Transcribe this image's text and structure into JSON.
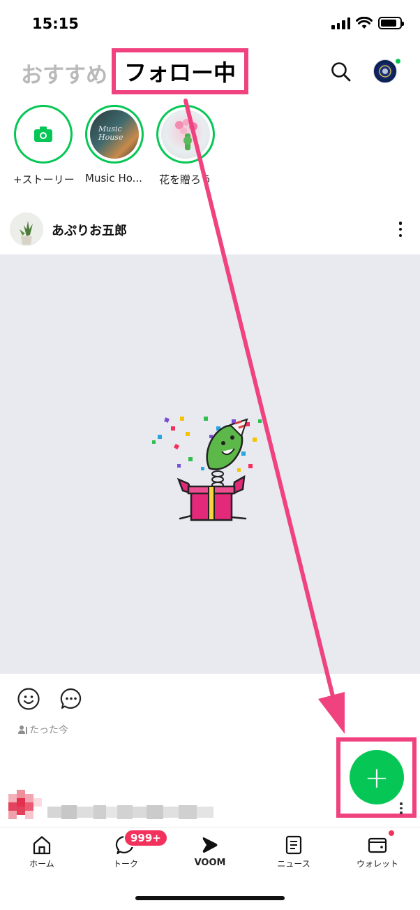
{
  "status_bar": {
    "time": "15:15",
    "battery_level": 0.85
  },
  "header": {
    "tabs": [
      {
        "label": "おすすめ",
        "active": false
      },
      {
        "label": "フォロー中",
        "active": true
      }
    ],
    "search_icon": "search-icon",
    "avatar_icon": "profile-avatar"
  },
  "stories": [
    {
      "label": "+ストーリー",
      "icon": "camera-icon"
    },
    {
      "label": "Music Ho...",
      "thumbnail_text": "Music House"
    },
    {
      "label": "花を贈ろう"
    }
  ],
  "post": {
    "author": "あぷりお五郎",
    "time": "たった今",
    "icons": [
      "smiley-icon",
      "comment-icon",
      "more-icon"
    ]
  },
  "fab": {
    "label": "+"
  },
  "bottom_nav": {
    "items": [
      {
        "label": "ホーム",
        "icon": "home-icon"
      },
      {
        "label": "トーク",
        "icon": "chat-icon"
      },
      {
        "label": "VOOM",
        "icon": "voom-icon"
      },
      {
        "label": "ニュース",
        "icon": "news-icon"
      },
      {
        "label": "ウォレット",
        "icon": "wallet-icon"
      }
    ],
    "talk_badge": "999+"
  },
  "colors": {
    "accent_green": "#06c755",
    "annotation_pink": "#f0427f",
    "badge_red": "#f2315c",
    "media_bg": "#e8eaf0"
  }
}
